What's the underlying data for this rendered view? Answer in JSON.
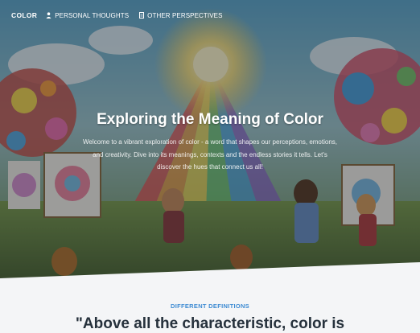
{
  "nav": {
    "brand": "COLOR",
    "links": [
      {
        "label": "PERSONAL THOUGHTS",
        "icon": "person-icon"
      },
      {
        "label": "OTHER PERSPECTIVES",
        "icon": "document-icon"
      }
    ]
  },
  "hero": {
    "title": "Exploring the Meaning of Color",
    "lead": "Welcome to a vibrant exploration of color - a word that shapes our perceptions, emotions, and creativity. Dive into its meanings, contexts and the endless stories it tells. Let's discover the hues that connect us all!"
  },
  "section": {
    "label": "DIFFERENT DEFINITIONS",
    "quote": "\"Above all the characteristic, color is"
  },
  "colors": {
    "accent": "#3d8bd3",
    "heading": "#26313c",
    "page_bg": "#f4f5f7"
  }
}
